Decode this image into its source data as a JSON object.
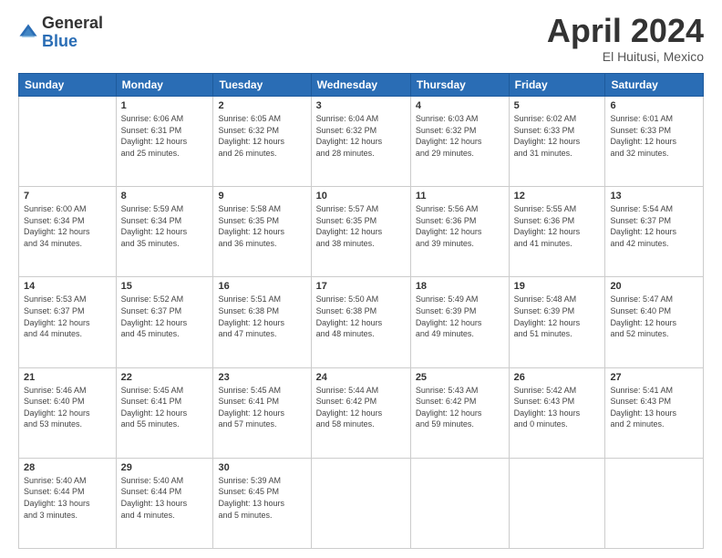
{
  "logo": {
    "general": "General",
    "blue": "Blue"
  },
  "header": {
    "month": "April 2024",
    "location": "El Huitusi, Mexico"
  },
  "weekdays": [
    "Sunday",
    "Monday",
    "Tuesday",
    "Wednesday",
    "Thursday",
    "Friday",
    "Saturday"
  ],
  "weeks": [
    [
      {
        "day": "",
        "info": ""
      },
      {
        "day": "1",
        "info": "Sunrise: 6:06 AM\nSunset: 6:31 PM\nDaylight: 12 hours\nand 25 minutes."
      },
      {
        "day": "2",
        "info": "Sunrise: 6:05 AM\nSunset: 6:32 PM\nDaylight: 12 hours\nand 26 minutes."
      },
      {
        "day": "3",
        "info": "Sunrise: 6:04 AM\nSunset: 6:32 PM\nDaylight: 12 hours\nand 28 minutes."
      },
      {
        "day": "4",
        "info": "Sunrise: 6:03 AM\nSunset: 6:32 PM\nDaylight: 12 hours\nand 29 minutes."
      },
      {
        "day": "5",
        "info": "Sunrise: 6:02 AM\nSunset: 6:33 PM\nDaylight: 12 hours\nand 31 minutes."
      },
      {
        "day": "6",
        "info": "Sunrise: 6:01 AM\nSunset: 6:33 PM\nDaylight: 12 hours\nand 32 minutes."
      }
    ],
    [
      {
        "day": "7",
        "info": "Sunrise: 6:00 AM\nSunset: 6:34 PM\nDaylight: 12 hours\nand 34 minutes."
      },
      {
        "day": "8",
        "info": "Sunrise: 5:59 AM\nSunset: 6:34 PM\nDaylight: 12 hours\nand 35 minutes."
      },
      {
        "day": "9",
        "info": "Sunrise: 5:58 AM\nSunset: 6:35 PM\nDaylight: 12 hours\nand 36 minutes."
      },
      {
        "day": "10",
        "info": "Sunrise: 5:57 AM\nSunset: 6:35 PM\nDaylight: 12 hours\nand 38 minutes."
      },
      {
        "day": "11",
        "info": "Sunrise: 5:56 AM\nSunset: 6:36 PM\nDaylight: 12 hours\nand 39 minutes."
      },
      {
        "day": "12",
        "info": "Sunrise: 5:55 AM\nSunset: 6:36 PM\nDaylight: 12 hours\nand 41 minutes."
      },
      {
        "day": "13",
        "info": "Sunrise: 5:54 AM\nSunset: 6:37 PM\nDaylight: 12 hours\nand 42 minutes."
      }
    ],
    [
      {
        "day": "14",
        "info": "Sunrise: 5:53 AM\nSunset: 6:37 PM\nDaylight: 12 hours\nand 44 minutes."
      },
      {
        "day": "15",
        "info": "Sunrise: 5:52 AM\nSunset: 6:37 PM\nDaylight: 12 hours\nand 45 minutes."
      },
      {
        "day": "16",
        "info": "Sunrise: 5:51 AM\nSunset: 6:38 PM\nDaylight: 12 hours\nand 47 minutes."
      },
      {
        "day": "17",
        "info": "Sunrise: 5:50 AM\nSunset: 6:38 PM\nDaylight: 12 hours\nand 48 minutes."
      },
      {
        "day": "18",
        "info": "Sunrise: 5:49 AM\nSunset: 6:39 PM\nDaylight: 12 hours\nand 49 minutes."
      },
      {
        "day": "19",
        "info": "Sunrise: 5:48 AM\nSunset: 6:39 PM\nDaylight: 12 hours\nand 51 minutes."
      },
      {
        "day": "20",
        "info": "Sunrise: 5:47 AM\nSunset: 6:40 PM\nDaylight: 12 hours\nand 52 minutes."
      }
    ],
    [
      {
        "day": "21",
        "info": "Sunrise: 5:46 AM\nSunset: 6:40 PM\nDaylight: 12 hours\nand 53 minutes."
      },
      {
        "day": "22",
        "info": "Sunrise: 5:45 AM\nSunset: 6:41 PM\nDaylight: 12 hours\nand 55 minutes."
      },
      {
        "day": "23",
        "info": "Sunrise: 5:45 AM\nSunset: 6:41 PM\nDaylight: 12 hours\nand 57 minutes."
      },
      {
        "day": "24",
        "info": "Sunrise: 5:44 AM\nSunset: 6:42 PM\nDaylight: 12 hours\nand 58 minutes."
      },
      {
        "day": "25",
        "info": "Sunrise: 5:43 AM\nSunset: 6:42 PM\nDaylight: 12 hours\nand 59 minutes."
      },
      {
        "day": "26",
        "info": "Sunrise: 5:42 AM\nSunset: 6:43 PM\nDaylight: 13 hours\nand 0 minutes."
      },
      {
        "day": "27",
        "info": "Sunrise: 5:41 AM\nSunset: 6:43 PM\nDaylight: 13 hours\nand 2 minutes."
      }
    ],
    [
      {
        "day": "28",
        "info": "Sunrise: 5:40 AM\nSunset: 6:44 PM\nDaylight: 13 hours\nand 3 minutes."
      },
      {
        "day": "29",
        "info": "Sunrise: 5:40 AM\nSunset: 6:44 PM\nDaylight: 13 hours\nand 4 minutes."
      },
      {
        "day": "30",
        "info": "Sunrise: 5:39 AM\nSunset: 6:45 PM\nDaylight: 13 hours\nand 5 minutes."
      },
      {
        "day": "",
        "info": ""
      },
      {
        "day": "",
        "info": ""
      },
      {
        "day": "",
        "info": ""
      },
      {
        "day": "",
        "info": ""
      }
    ]
  ]
}
